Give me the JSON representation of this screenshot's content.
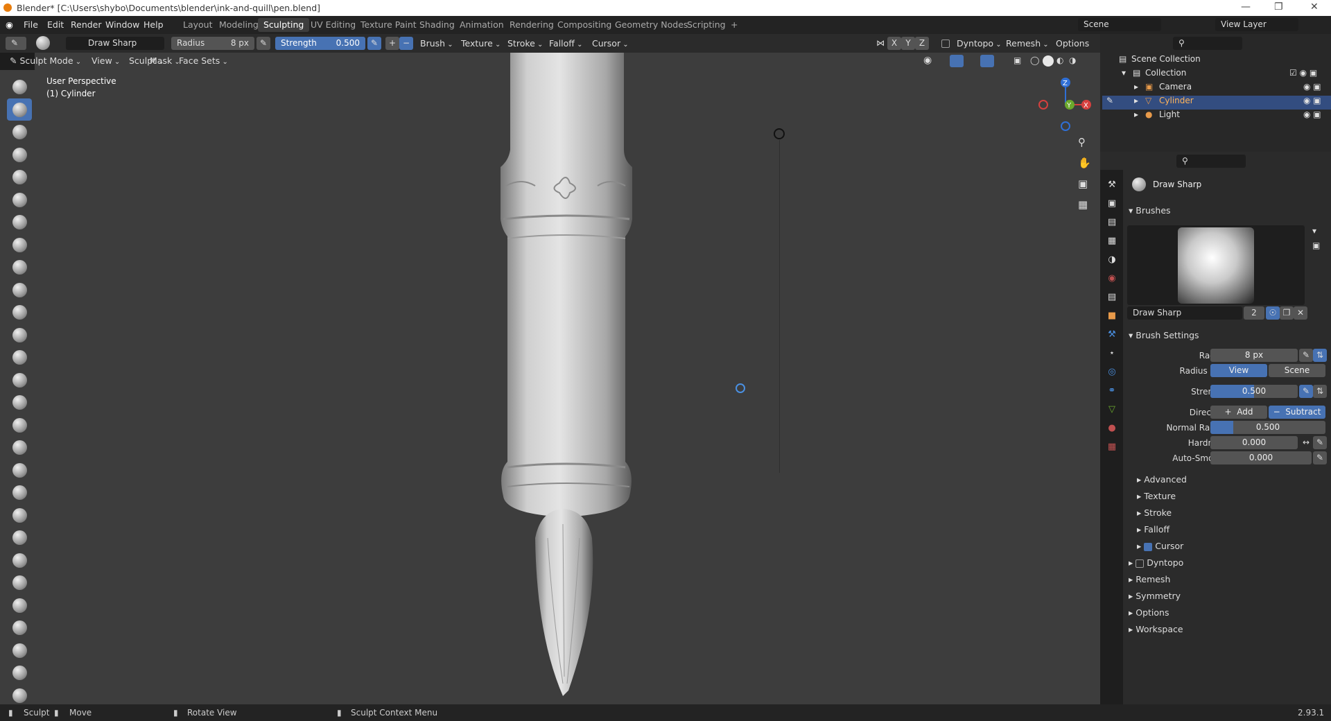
{
  "window": {
    "title": "Blender* [C:\\Users\\shybo\\Documents\\blender\\ink-and-quill\\pen.blend]"
  },
  "menu": [
    "File",
    "Edit",
    "Render",
    "Window",
    "Help"
  ],
  "workspaces": [
    "Layout",
    "Modeling",
    "Sculpting",
    "UV Editing",
    "Texture Paint",
    "Shading",
    "Animation",
    "Rendering",
    "Compositing",
    "Geometry Nodes",
    "Scripting"
  ],
  "active_workspace": "Sculpting",
  "scene": {
    "label": "Scene",
    "view_layer": "View Layer"
  },
  "tool_header": {
    "brush_name": "Draw Sharp",
    "radius_label": "Radius",
    "radius_value": "8 px",
    "strength_label": "Strength",
    "strength_value": "0.500",
    "menus": [
      "Brush",
      "Texture",
      "Stroke",
      "Falloff",
      "Cursor"
    ],
    "axes": [
      "X",
      "Y",
      "Z"
    ],
    "dyntopo": "Dyntopo",
    "remesh": "Remesh",
    "options": "Options"
  },
  "viewport_header": {
    "mode": "Sculpt Mode",
    "menus": [
      "View",
      "Sculpt",
      "Mask",
      "Face Sets"
    ]
  },
  "viewport": {
    "perspective": "User Perspective",
    "object": "(1) Cylinder"
  },
  "outliner": {
    "root": "Scene Collection",
    "collection": "Collection",
    "items": [
      {
        "name": "Camera",
        "selected": false
      },
      {
        "name": "Cylinder",
        "selected": true
      },
      {
        "name": "Light",
        "selected": false
      }
    ]
  },
  "properties": {
    "brush_name": "Draw Sharp",
    "brushes_title": "Brushes",
    "brush_field": "Draw Sharp",
    "brush_users": "2",
    "brush_settings_title": "Brush Settings",
    "radius": {
      "label": "Radius",
      "value": "8 px"
    },
    "radius_unit": {
      "label": "Radius Unit",
      "options": [
        "View",
        "Scene"
      ]
    },
    "strength": {
      "label": "Strength",
      "value": "0.500",
      "fraction": 0.5
    },
    "direction": {
      "label": "Direction",
      "options": [
        "Add",
        "Subtract"
      ]
    },
    "normal_radius": {
      "label": "Normal Radius",
      "value": "0.500",
      "fraction": 0.5
    },
    "hardness": {
      "label": "Hardness",
      "value": "0.000"
    },
    "auto_smooth": {
      "label": "Auto-Smooth",
      "value": "0.000"
    },
    "subsections": [
      "Advanced",
      "Texture",
      "Stroke",
      "Falloff",
      "Cursor"
    ],
    "sections": [
      "Dyntopo",
      "Remesh",
      "Symmetry",
      "Options",
      "Workspace"
    ]
  },
  "statusbar": {
    "items": [
      "Sculpt",
      "Move",
      "Rotate View",
      "Sculpt Context Menu"
    ],
    "version": "2.93.1"
  },
  "colors": {
    "accent": "#4772b3",
    "viewport": "#3d3d3d",
    "selected_row": "#334d80"
  }
}
